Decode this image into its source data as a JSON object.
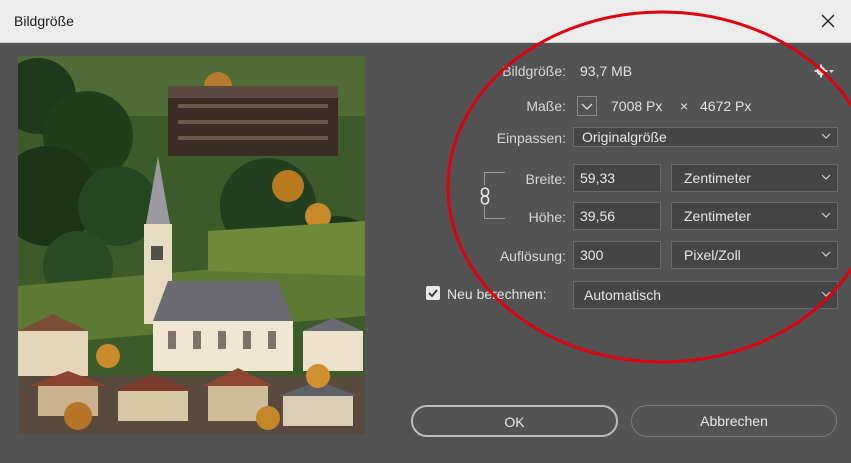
{
  "window": {
    "title": "Bildgröße",
    "close_symbol": "✕"
  },
  "size": {
    "label": "Bildgröße:",
    "value": "93,7 MB"
  },
  "dimensions": {
    "label": "Maße:",
    "width": "7008 Px",
    "times": "×",
    "height": "4672 Px"
  },
  "fit": {
    "label": "Einpassen:",
    "value": "Originalgröße"
  },
  "width_field": {
    "label": "Breite:",
    "value": "59,33",
    "unit": "Zentimeter"
  },
  "height_field": {
    "label": "Höhe:",
    "value": "39,56",
    "unit": "Zentimeter"
  },
  "resolution": {
    "label": "Auflösung:",
    "value": "300",
    "unit": "Pixel/Zoll"
  },
  "resample": {
    "label": "Neu berechnen:",
    "checked": true,
    "value": "Automatisch"
  },
  "buttons": {
    "ok": "OK",
    "cancel": "Abbrechen"
  },
  "colors": {
    "dialog_bg": "#535353",
    "field_bg": "#454545",
    "annotation": "#e0000f"
  }
}
